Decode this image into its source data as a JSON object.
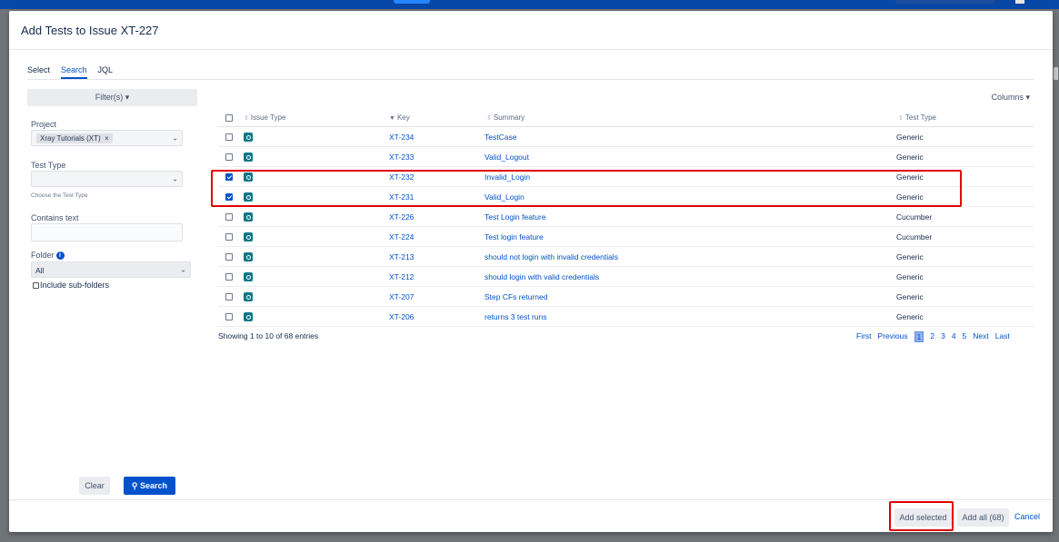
{
  "modal": {
    "title": "Add Tests to Issue XT-227",
    "tabs": [
      "Select",
      "Search",
      "JQL"
    ],
    "active_tab": "Search"
  },
  "filters": {
    "filter_button": "Filter(s) ▾",
    "project_label": "Project",
    "project_value": "Xray Tutorials (XT)",
    "project_remove": "×",
    "test_type_label": "Test Type",
    "test_type_hint": "Choose the Test Type",
    "contains_text_label": "Contains text",
    "contains_text_value": "",
    "folder_label": "Folder",
    "folder_value": "All",
    "include_subfolders_label": "Include sub-folders",
    "include_subfolders_checked": false,
    "clear_button": "Clear",
    "search_button": "Search"
  },
  "table": {
    "columns_button": "Columns ▾",
    "headers": {
      "issue_type": "Issue Type",
      "key": "Key",
      "summary": "Summary",
      "test_type": "Test Type"
    },
    "rows": [
      {
        "checked": false,
        "key": "XT-234",
        "summary": "TestCase",
        "test_type": "Generic"
      },
      {
        "checked": false,
        "key": "XT-233",
        "summary": "Valid_Logout",
        "test_type": "Generic"
      },
      {
        "checked": true,
        "key": "XT-232",
        "summary": "Invalid_Login",
        "test_type": "Generic"
      },
      {
        "checked": true,
        "key": "XT-231",
        "summary": "Valid_Login",
        "test_type": "Generic"
      },
      {
        "checked": false,
        "key": "XT-226",
        "summary": "Test Login feature",
        "test_type": "Cucumber"
      },
      {
        "checked": false,
        "key": "XT-224",
        "summary": "Test login feature",
        "test_type": "Cucumber"
      },
      {
        "checked": false,
        "key": "XT-213",
        "summary": "should not login with invalid credentials",
        "test_type": "Generic"
      },
      {
        "checked": false,
        "key": "XT-212",
        "summary": "should login with valid credentials",
        "test_type": "Generic"
      },
      {
        "checked": false,
        "key": "XT-207",
        "summary": "Step CFs returned",
        "test_type": "Generic"
      },
      {
        "checked": false,
        "key": "XT-206",
        "summary": "returns 3 test runs",
        "test_type": "Generic"
      }
    ],
    "showing": "Showing 1 to 10 of 68 entries",
    "pagination": {
      "first": "First",
      "previous": "Previous",
      "pages": [
        "1",
        "2",
        "3",
        "4",
        "5"
      ],
      "current": "1",
      "next": "Next",
      "last": "Last"
    }
  },
  "footer": {
    "add_selected": "Add selected",
    "add_all": "Add all (68)",
    "cancel": "Cancel"
  },
  "colors": {
    "accent": "#0052cc",
    "highlight": "#e00000",
    "issue_icon": "#097985"
  }
}
